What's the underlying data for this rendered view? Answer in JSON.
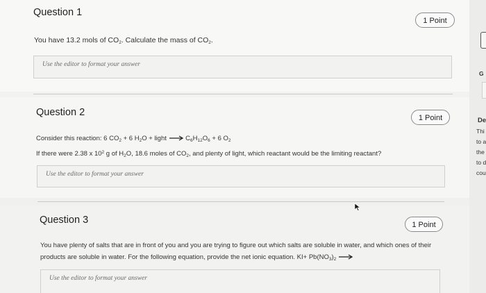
{
  "questions": [
    {
      "title": "Question 1",
      "points": "1 Point",
      "text_parts": [
        "You have 13.2 mols of CO",
        "2",
        ". Calculate the mass of CO",
        "2",
        "."
      ],
      "placeholder": "Use the editor to format your answer"
    },
    {
      "title": "Question 2",
      "points": "1 Point",
      "line1_parts": [
        "Consider this reaction: 6 CO",
        "2",
        " + 6 H",
        "2",
        "O + light",
        "C",
        "6",
        "H",
        "12",
        "O",
        "6",
        " + 6 O",
        "2"
      ],
      "line2_parts": [
        "If there were 2.38 x 10",
        "2",
        " g of H",
        "2",
        "O, 18.6 moles of CO",
        "2",
        ", and plenty of light, which reactant would be the limiting reactant?"
      ],
      "placeholder": "Use the editor to format your answer"
    },
    {
      "title": "Question 3",
      "points": "1 Point",
      "line1": "You have plenty of salts that are in front of you and you are trying to figure out which salts are soluble in water, and which ones of their",
      "line2_parts": [
        "products are soluble in water. For the following equation, provide the net ionic equation. KI+ Pb(NO",
        "3",
        ")",
        "2"
      ],
      "placeholder": "Use the editor to format your answer"
    }
  ],
  "side_panel": {
    "fragments": [
      "G",
      "De",
      "Thi",
      "to a",
      "the",
      "to d",
      "cou"
    ]
  },
  "icons": {
    "reaction_arrow": "right-arrow-icon",
    "cursor": "mouse-pointer-icon"
  }
}
